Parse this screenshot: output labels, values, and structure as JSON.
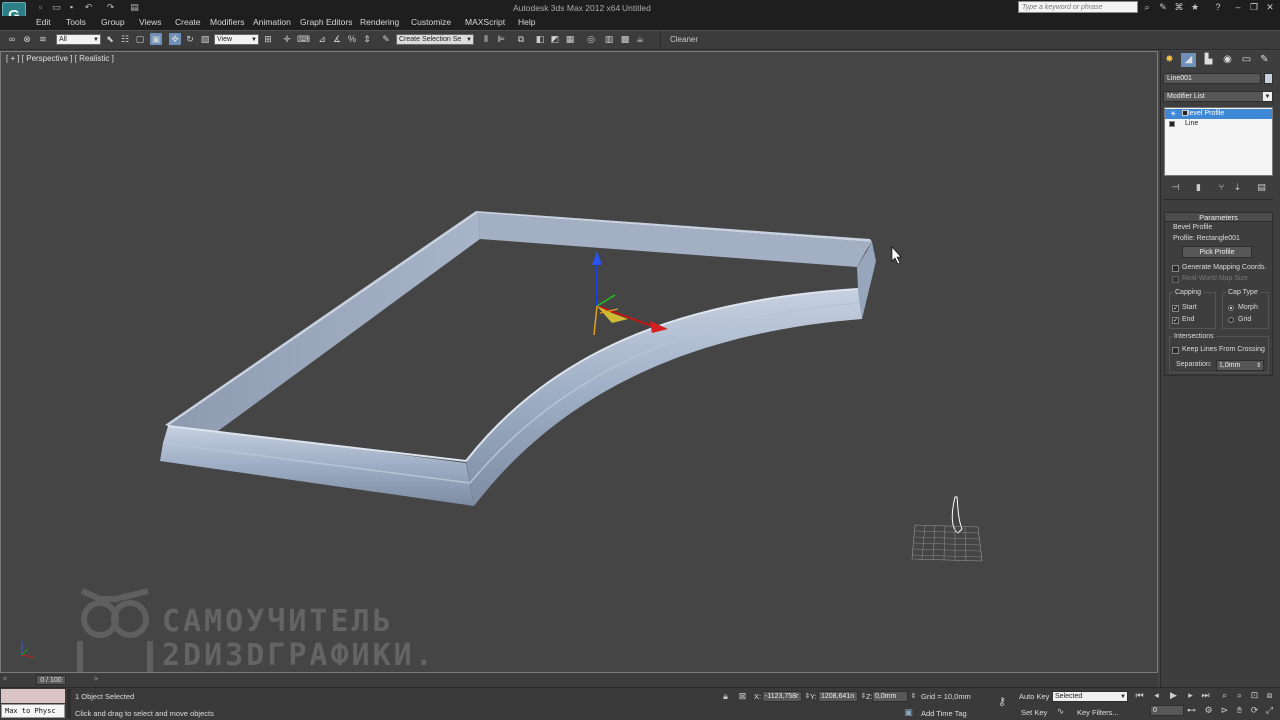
{
  "window": {
    "title": "Autodesk 3ds Max 2012 x64",
    "document": "Untitled",
    "help_search_placeholder": "Type a keyword or phrase"
  },
  "menu": [
    "Edit",
    "Tools",
    "Group",
    "Views",
    "Create",
    "Modifiers",
    "Animation",
    "Graph Editors",
    "Rendering",
    "Customize",
    "MAXScript",
    "Help"
  ],
  "toolbar": {
    "selection_filter": "All",
    "ref_coord": "View",
    "named_selection": "Create Selection Se",
    "cleaner_label": "Cleaner"
  },
  "viewport": {
    "label": "[ + ] [ Perspective ] [ Realistic ]"
  },
  "command_panel": {
    "object_name": "Line001",
    "modifier_list": "Modifier List",
    "stack": [
      {
        "label": "Bevel Profile",
        "selected": true
      },
      {
        "label": "Line",
        "selected": false
      }
    ],
    "parameters": {
      "header": "Parameters",
      "section": "Bevel Profile",
      "profile_text": "Profile: Rectangle001",
      "pick_profile_button": "Pick Profile",
      "generate_mapping": "Generate Mapping Coords.",
      "real_world_map": "Real-World Map Size",
      "capping_label": "Capping",
      "cap_start": "Start",
      "cap_end": "End",
      "cap_type_label": "Cap Type",
      "cap_morph": "Morph",
      "cap_grid": "Grid",
      "intersections_label": "Intersections",
      "keep_lines": "Keep Lines From Crossing",
      "separation_label": "Separation:",
      "separation_value": "1,0mm"
    }
  },
  "timeline": {
    "frame": "0 / 100"
  },
  "status": {
    "maxscript_text": "Max to Physc",
    "selection": "1 Object Selected",
    "prompt": "Click and drag to select and move objects",
    "x_label": "X:",
    "x_value": "-1123,758r",
    "y_label": "Y:",
    "y_value": "1208,641n",
    "z_label": "Z:",
    "z_value": "0,0mm",
    "grid": "Grid = 10,0mm",
    "auto_key": "Auto Key",
    "key_mode": "Selected",
    "set_key": "Set Key",
    "key_filters": "Key Filters...",
    "add_time_tag": "Add Time Tag",
    "current_frame": "0"
  },
  "watermark": {
    "line1": "САМОУЧИТЕЛЬ",
    "line2": "2DИ3DГРАФИКИ."
  }
}
